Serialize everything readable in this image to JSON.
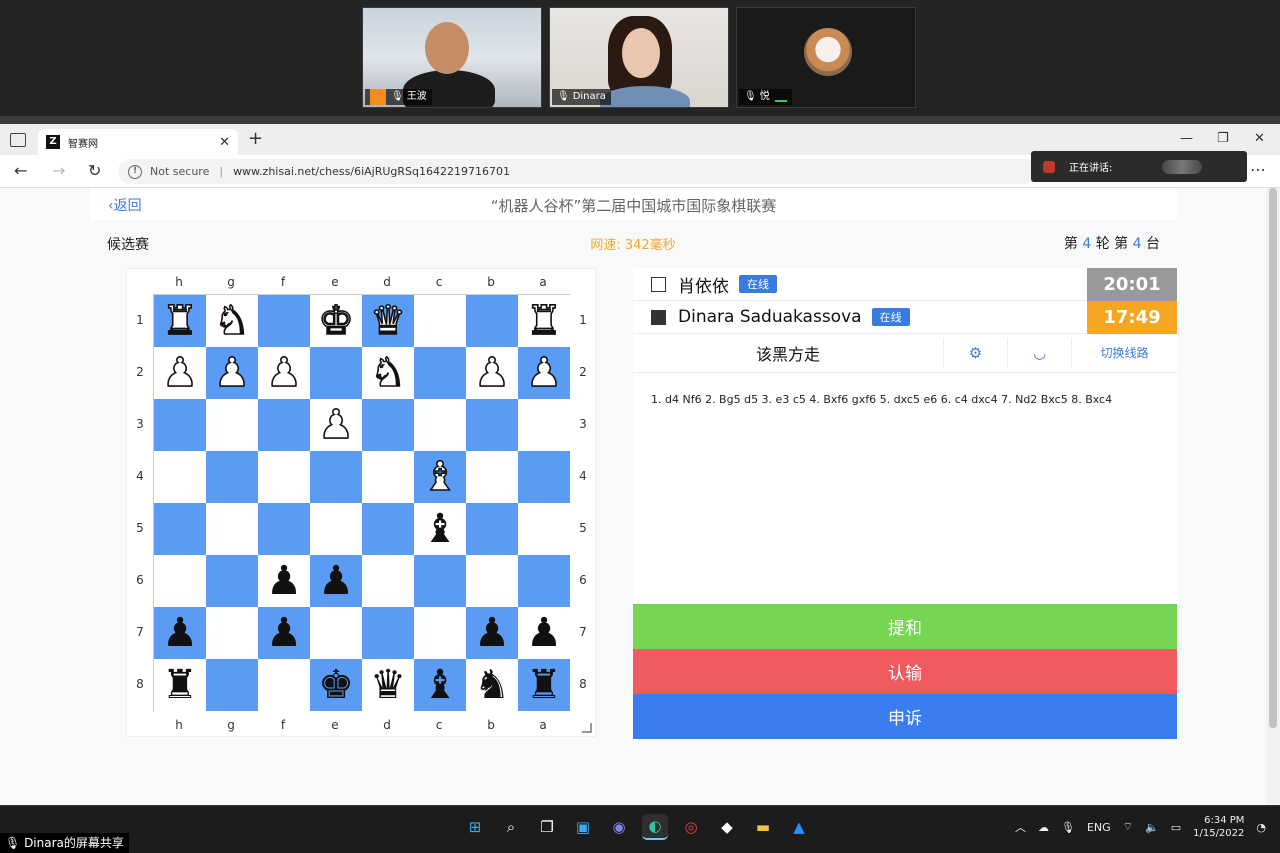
{
  "meeting": {
    "participants": [
      {
        "name": "王波"
      },
      {
        "name": "Dinara"
      },
      {
        "name": "悦"
      }
    ],
    "speaking_label": "正在讲话:",
    "share_label": "Dinara的屏幕共享"
  },
  "browser": {
    "tab_title": "智赛网",
    "tab_favicon": "Z",
    "security": "Not secure",
    "url": "www.zhisai.net/chess/6iAjRUgRSq1642219716701"
  },
  "page": {
    "back_label": "返回",
    "event_title": "“机器人谷杯”第二届中国城市国际象棋联赛",
    "section": "候选赛",
    "speed": "网速: 342毫秒",
    "round_prefix": "第",
    "round_num": "4",
    "round_word": "轮 第",
    "board_num": "4",
    "board_word": "台"
  },
  "board": {
    "files": [
      "h",
      "g",
      "f",
      "e",
      "d",
      "c",
      "b",
      "a"
    ],
    "ranks": [
      "1",
      "2",
      "3",
      "4",
      "5",
      "6",
      "7",
      "8"
    ],
    "light_color": "#ffffff",
    "dark_color": "#5a9bf5",
    "squares": [
      [
        "wR",
        "wN",
        "",
        "wK",
        "wQ",
        "",
        "",
        "wR"
      ],
      [
        "wP",
        "wP",
        "wP",
        "",
        "wN",
        "",
        "wP",
        "wP"
      ],
      [
        "",
        "",
        "",
        "wP",
        "",
        "",
        "",
        ""
      ],
      [
        "",
        "",
        "",
        "",
        "",
        "wB",
        "",
        ""
      ],
      [
        "",
        "",
        "",
        "",
        "",
        "bB",
        "",
        ""
      ],
      [
        "",
        "",
        "bP",
        "bP",
        "",
        "",
        "",
        ""
      ],
      [
        "bP",
        "",
        "bP",
        "",
        "",
        "",
        "bP",
        "bP"
      ],
      [
        "bR",
        "",
        "",
        "bK",
        "bQ",
        "bB",
        "bN",
        "bR"
      ]
    ]
  },
  "players": {
    "white": {
      "name": "肖依依",
      "status": "在线",
      "clock": "20:01"
    },
    "black": {
      "name": "Dinara Saduakassova",
      "status": "在线",
      "clock": "17:49"
    }
  },
  "game": {
    "turn": "该黑方走",
    "switch_line": "切换线路",
    "moves": "1. d4 Nf6 2. Bg5 d5 3. e3 c5 4. Bxf6 gxf6 5. dxc5 e6 6. c4 dxc4 7. Nd2 Bxc5 8. Bxc4"
  },
  "actions": {
    "draw": "提和",
    "resign": "认输",
    "appeal": "申诉"
  },
  "taskbar": {
    "lang": "ENG",
    "time": "6:34 PM",
    "date": "1/15/2022"
  }
}
